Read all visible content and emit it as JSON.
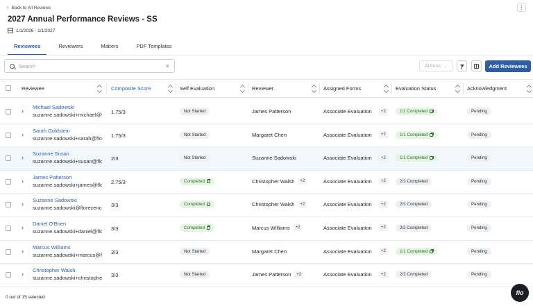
{
  "header": {
    "back_label": "Back to All Reviews",
    "title": "2027 Annual Performance Reviews - SS",
    "date_range": "1/1/2026 - 1/1/2027"
  },
  "tabs": [
    {
      "label": "Reviewees",
      "active": true
    },
    {
      "label": "Reviewers",
      "active": false
    },
    {
      "label": "Matters",
      "active": false
    },
    {
      "label": "PDF Templates",
      "active": false
    }
  ],
  "toolbar": {
    "search_placeholder": "Search",
    "search_value": "",
    "actions_label": "Actions",
    "add_label": "Add Reviewees"
  },
  "table": {
    "columns": [
      "Reviewee",
      "Composite Score",
      "Self Evaluation",
      "Reviewer",
      "Assigned Forms",
      "Evaluation Status",
      "Acknowledgment"
    ],
    "rows": [
      {
        "name": "Michael Sadowski",
        "email": "suzanne.sadowski+michael@florecence.com",
        "score": "1.75/3",
        "self_eval": "Not Started",
        "self_done": false,
        "reviewer": "James Patterson",
        "reviewer_extra": "",
        "forms": "Associate Evaluation",
        "forms_extra": "+2",
        "eval_status": "1/1 Completed",
        "eval_done": true,
        "ack": "Pending",
        "highlight": false
      },
      {
        "name": "Sarah Goldstein",
        "email": "suzanne.sadowski+sarah@florecence.com",
        "score": "1.75/3",
        "self_eval": "Not Started",
        "self_done": false,
        "reviewer": "Margaret Chen",
        "reviewer_extra": "",
        "forms": "Associate Evaluation",
        "forms_extra": "+2",
        "eval_status": "1/1 Completed",
        "eval_done": true,
        "ack": "Pending",
        "highlight": false
      },
      {
        "name": "Suzanne Susan",
        "email": "suzanne.sadowski+susan@florecence.com",
        "score": "2/3",
        "self_eval": "Not Started",
        "self_done": false,
        "reviewer": "Suzanne Sadowski",
        "reviewer_extra": "",
        "forms": "Associate Evaluation",
        "forms_extra": "+2",
        "eval_status": "1/1 Completed",
        "eval_done": true,
        "ack": "Pending",
        "highlight": true
      },
      {
        "name": "James Patterson",
        "email": "suzanne.sadowski+james@florecence.com",
        "score": "2.75/3",
        "self_eval": "Completed",
        "self_done": true,
        "reviewer": "Christopher Walsh",
        "reviewer_extra": "+2",
        "forms": "Associate Evaluation",
        "forms_extra": "+2",
        "eval_status": "2/3 Completed",
        "eval_done": false,
        "ack": "Pending",
        "highlight": false
      },
      {
        "name": "Suzanne Sadowski",
        "email": "suzanne.sadowski@florecence.com",
        "score": "3/3",
        "self_eval": "Completed",
        "self_done": true,
        "reviewer": "Christopher Walsh",
        "reviewer_extra": "+2",
        "forms": "Associate Evaluation",
        "forms_extra": "+2",
        "eval_status": "2/3 Completed",
        "eval_done": false,
        "ack": "Pending",
        "highlight": false
      },
      {
        "name": "Daniel O'Brien",
        "email": "suzanne.sadowski+daniel@florecence.com",
        "score": "3/3",
        "self_eval": "Completed",
        "self_done": true,
        "reviewer": "Marcus Williams",
        "reviewer_extra": "+2",
        "forms": "Associate Evaluation",
        "forms_extra": "+2",
        "eval_status": "2/3 Completed",
        "eval_done": false,
        "ack": "Pending",
        "highlight": false
      },
      {
        "name": "Marcus Williams",
        "email": "suzanne.sadowski+marcus@florecence.com",
        "score": "3/3",
        "self_eval": "Not Started",
        "self_done": false,
        "reviewer": "Margaret Chen",
        "reviewer_extra": "",
        "forms": "Associate Evaluation",
        "forms_extra": "+2",
        "eval_status": "1/1 Completed",
        "eval_done": true,
        "ack": "Pending",
        "highlight": false
      },
      {
        "name": "Christopher Walsh",
        "email": "suzanne.sadowski+christopher@florecence.com",
        "score": "3/3",
        "self_eval": "Not Started",
        "self_done": false,
        "reviewer": "James Patterson",
        "reviewer_extra": "+2",
        "forms": "Associate Evaluation",
        "forms_extra": "+2",
        "eval_status": "2/3 Completed",
        "eval_done": false,
        "ack": "Pending",
        "highlight": false
      }
    ]
  },
  "footer": {
    "selection": "0 out of 15 selected"
  },
  "fab_label": "flo"
}
